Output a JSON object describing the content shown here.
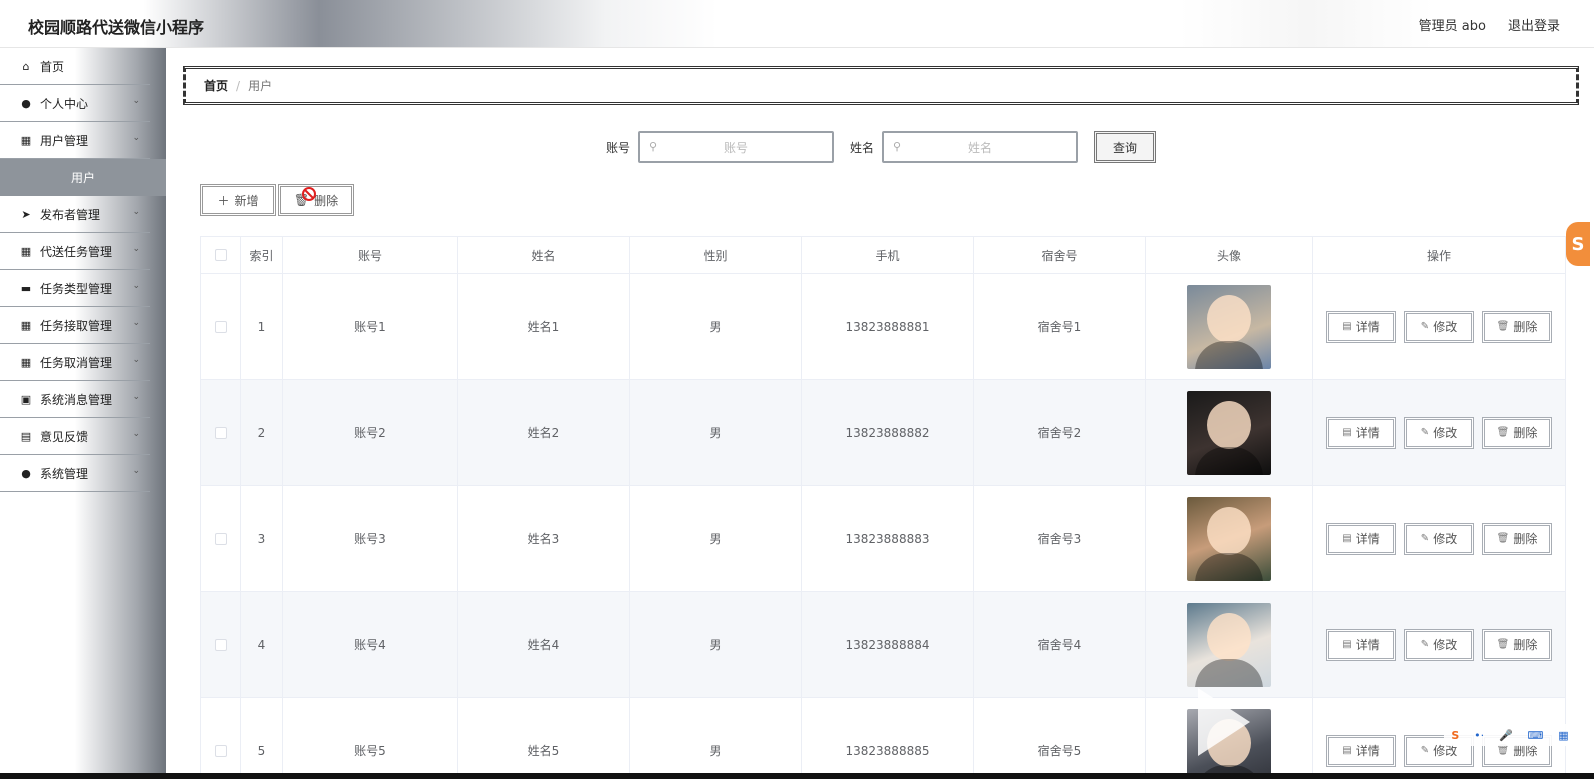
{
  "header": {
    "title": "校园顺路代送微信小程序",
    "user": "管理员 abo",
    "logout": "退出登录"
  },
  "sidebar": {
    "items": [
      {
        "label": "首页",
        "icon": "home-icon",
        "glyph": "⌂",
        "expandable": false
      },
      {
        "label": "个人中心",
        "icon": "person-icon",
        "glyph": "●",
        "expandable": true
      },
      {
        "label": "用户管理",
        "icon": "grid-icon",
        "glyph": "▦",
        "expandable": true
      },
      {
        "label": "发布者管理",
        "icon": "send-icon",
        "glyph": "➤",
        "expandable": true
      },
      {
        "label": "代送任务管理",
        "icon": "grid-icon",
        "glyph": "▦",
        "expandable": true
      },
      {
        "label": "任务类型管理",
        "icon": "comment-icon",
        "glyph": "▬",
        "expandable": true
      },
      {
        "label": "任务接取管理",
        "icon": "grid-icon",
        "glyph": "▦",
        "expandable": true
      },
      {
        "label": "任务取消管理",
        "icon": "grid-icon",
        "glyph": "▦",
        "expandable": true
      },
      {
        "label": "系统消息管理",
        "icon": "clipboard-icon",
        "glyph": "▣",
        "expandable": true
      },
      {
        "label": "意见反馈",
        "icon": "briefcase-icon",
        "glyph": "▤",
        "expandable": true
      },
      {
        "label": "系统管理",
        "icon": "user-icon",
        "glyph": "●",
        "expandable": true
      }
    ],
    "active_sub": "用户"
  },
  "breadcrumb": {
    "home": "首页",
    "sep": "/",
    "current": "用户"
  },
  "search": {
    "account_label": "账号",
    "account_placeholder": "账号",
    "name_label": "姓名",
    "name_placeholder": "姓名",
    "query_button": "查询"
  },
  "actions": {
    "add": "新增",
    "delete": "删除"
  },
  "table": {
    "headers": [
      "",
      "索引",
      "账号",
      "姓名",
      "性别",
      "手机",
      "宿舍号",
      "头像",
      "操作"
    ],
    "rows": [
      {
        "index": "1",
        "account": "账号1",
        "name": "姓名1",
        "gender": "男",
        "phone": "13823888881",
        "dorm": "宿舍号1"
      },
      {
        "index": "2",
        "account": "账号2",
        "name": "姓名2",
        "gender": "男",
        "phone": "13823888882",
        "dorm": "宿舍号2"
      },
      {
        "index": "3",
        "account": "账号3",
        "name": "姓名3",
        "gender": "男",
        "phone": "13823888883",
        "dorm": "宿舍号3"
      },
      {
        "index": "4",
        "account": "账号4",
        "name": "姓名4",
        "gender": "男",
        "phone": "13823888884",
        "dorm": "宿舍号4"
      },
      {
        "index": "5",
        "account": "账号5",
        "name": "姓名5",
        "gender": "男",
        "phone": "13823888885",
        "dorm": "宿舍号5"
      }
    ],
    "row_actions": {
      "detail": "详情",
      "edit": "修改",
      "delete": "删除"
    }
  },
  "float_badge": "S",
  "colors": {
    "sidebar_active": "#8e949b",
    "row_alt": "#f5f7fa",
    "badge": "#f28e3b"
  }
}
